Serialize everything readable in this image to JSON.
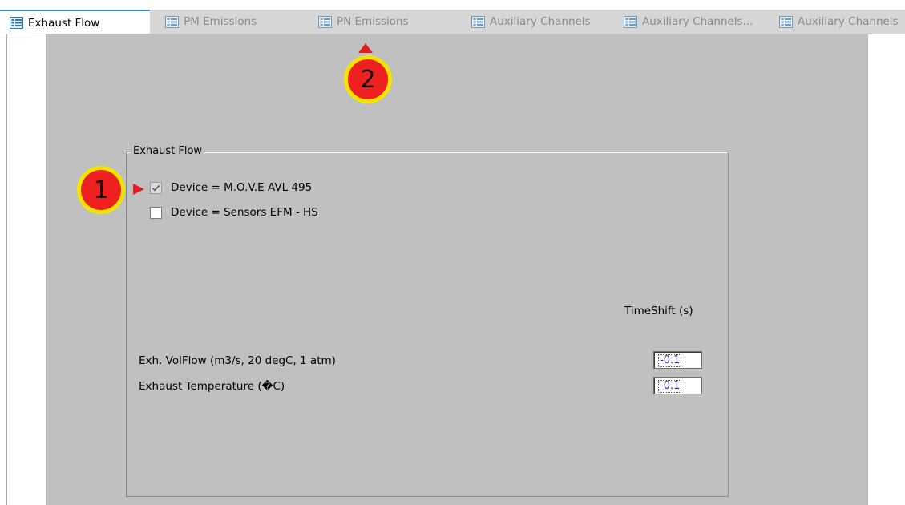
{
  "tabs": [
    {
      "label": "Exhaust Flow",
      "active": true
    },
    {
      "label": "PM Emissions",
      "active": false
    },
    {
      "label": "PN Emissions",
      "active": false
    },
    {
      "label": "Auxiliary Channels",
      "active": false
    },
    {
      "label": "Auxiliary Channels...",
      "active": false
    },
    {
      "label": "Auxiliary Channels",
      "active": false
    }
  ],
  "group": {
    "title": "Exhaust Flow",
    "devices": [
      {
        "label": "Device = M.O.V.E AVL 495",
        "checked": true
      },
      {
        "label": "Device = Sensors EFM - HS",
        "checked": false
      }
    ],
    "timeshift_header": "TimeShift (s)",
    "channels": [
      {
        "label": "Exh. VolFlow (m3/s, 20 degC, 1 atm)",
        "value": "-0.1"
      },
      {
        "label": "Exhaust Temperature (�C)",
        "value": "-0.1"
      }
    ]
  },
  "annotations": {
    "badge1": "1",
    "badge2": "2"
  },
  "colors": {
    "badge_fill": "#ee2020",
    "badge_ring": "#f5e400",
    "tab_accent": "#3b8fc7",
    "panel_bg": "#c0c0c0"
  }
}
